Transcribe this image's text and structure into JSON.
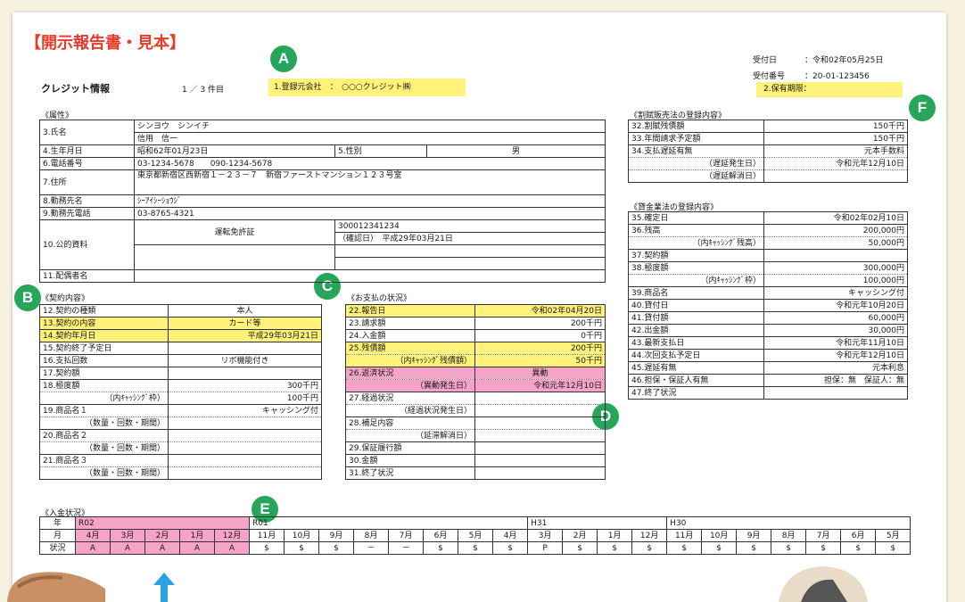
{
  "title": "【開示報告書・見本】",
  "receipt": {
    "date_label": "受付日",
    "date_value": "：令和02年05月25日",
    "no_label": "受付番号",
    "no_value": "：20-01-123456"
  },
  "credit": {
    "label": "クレジット情報",
    "count": "1 ／ 3 件目",
    "registrant": "1.登録元会社　：　○○○クレジット㈱",
    "retention": "2.保有期限："
  },
  "badges": {
    "a": "A",
    "b": "B",
    "c": "C",
    "d": "D",
    "e": "E",
    "f": "F"
  },
  "attr": {
    "section": "《属性》",
    "name_label": "3.氏名",
    "name_kana": "シンヨウ　シンイチ",
    "name_kanji": "信用　信一",
    "birth_label": "4.生年月日",
    "birth_value": "昭和62年01月23日",
    "sex_label": "5.性別",
    "sex_value": "男",
    "phone_label": "6.電話番号",
    "phone_value": "03-1234-5678　　090-1234-5678",
    "addr_label": "7.住所",
    "addr_value": "東京都新宿区西新宿１－２３－７　新宿ファーストマンション１２３号室",
    "work_label": "8.勤務先名",
    "work_value": "ｼｰｱｲｼｰｼｮｳｼﾞ",
    "workphone_label": "9.勤務先電話",
    "workphone_value": "03-8765-4321",
    "docs_label": "10.公的資料",
    "docs_type": "運転免許証",
    "docs_no": "300012341234",
    "docs_confirm": "（確認日）　平成29年03月21日",
    "spouse_label": "11.配偶者名"
  },
  "contract": {
    "section": "《契約内容》",
    "rows": [
      {
        "k": "12.契約の種類",
        "v": "本人"
      },
      {
        "k": "13.契約の内容",
        "v": "カード等"
      },
      {
        "k": "14.契約年月日",
        "v": "平成29年03月21日"
      },
      {
        "k": "15.契約終了予定日",
        "v": ""
      },
      {
        "k": "16.支払回数",
        "v": "リボ機能付き"
      },
      {
        "k": "17.契約額",
        "v": ""
      },
      {
        "k": "18.極度額",
        "v": "300千円"
      },
      {
        "k": "（内ｷｬｯｼﾝｸﾞ枠）",
        "v": "100千円"
      },
      {
        "k": "19.商品名１",
        "v": "キャッシング付"
      },
      {
        "k": "（数量・回数・期間）",
        "v": ""
      },
      {
        "k": "20.商品名２",
        "v": ""
      },
      {
        "k": "（数量・回数・期間）",
        "v": ""
      },
      {
        "k": "21.商品名３",
        "v": ""
      },
      {
        "k": "（数量・回数・期間）",
        "v": ""
      }
    ]
  },
  "payment": {
    "section": "《お支払の状況》",
    "rows": [
      {
        "k": "22.報告日",
        "v": "令和02年04月20日"
      },
      {
        "k": "23.請求額",
        "v": "200千円"
      },
      {
        "k": "24.入金額",
        "v": "0千円"
      },
      {
        "k": "25.残債額",
        "v": "200千円"
      },
      {
        "k": "（内ｷｬｯｼﾝｸﾞ残債額）",
        "v": "50千円"
      },
      {
        "k": "26.返済状況",
        "v": "異動"
      },
      {
        "k": "（異動発生日）",
        "v": "令和元年12月10日"
      },
      {
        "k": "27.経過状況",
        "v": ""
      },
      {
        "k": "（経過状況発生日）",
        "v": ""
      },
      {
        "k": "28.補足内容",
        "v": ""
      },
      {
        "k": "（延滞解消日）",
        "v": ""
      },
      {
        "k": "29.保証履行額",
        "v": ""
      },
      {
        "k": "30.金額",
        "v": ""
      },
      {
        "k": "31.終了状況",
        "v": ""
      }
    ]
  },
  "installment": {
    "section": "《割賦販売法の登録内容》",
    "rows": [
      {
        "k": "32.割賦残債額",
        "v": "150千円"
      },
      {
        "k": "33.年間請求予定額",
        "v": "150千円"
      },
      {
        "k": "34.支払遅延有無",
        "v": "元本手数料"
      },
      {
        "k": "（遅延発生日）",
        "v": "令和元年12月10日"
      },
      {
        "k": "（遅延解消日）",
        "v": ""
      }
    ]
  },
  "money": {
    "section": "《貸金業法の登録内容》",
    "rows": [
      {
        "k": "35.確定日",
        "v": "令和02年02月10日"
      },
      {
        "k": "36.残高",
        "v": "200,000円"
      },
      {
        "k": "（内ｷｬｯｼﾝｸﾞ残高）",
        "v": "50,000円"
      },
      {
        "k": "37.契約額",
        "v": ""
      },
      {
        "k": "38.極度額",
        "v": "300,000円"
      },
      {
        "k": "（内ｷｬｯｼﾝｸﾞ枠）",
        "v": "100,000円"
      },
      {
        "k": "39.商品名",
        "v": "キャッシング付"
      },
      {
        "k": "40.貸付日",
        "v": "令和元年10月20日"
      },
      {
        "k": "41.貸付額",
        "v": "60,000円"
      },
      {
        "k": "42.出金額",
        "v": "30,000円"
      },
      {
        "k": "43.最新支払日",
        "v": "令和元年11月10日"
      },
      {
        "k": "44.次回支払予定日",
        "v": "令和元年12月10日"
      },
      {
        "k": "45.遅延有無",
        "v": "元本利息"
      },
      {
        "k": "46.担保・保証人有無",
        "v": "担保：無　保証人：無"
      },
      {
        "k": "47.終了状況",
        "v": ""
      }
    ]
  },
  "deposit": {
    "section": "《入金状況》",
    "year_label": "年",
    "month_label": "月",
    "status_label": "状況",
    "years": [
      "R02",
      "R01",
      "H31",
      "H30"
    ],
    "months": [
      "4月",
      "3月",
      "2月",
      "1月",
      "12月",
      "11月",
      "10月",
      "9月",
      "8月",
      "7月",
      "6月",
      "5月",
      "4月",
      "3月",
      "2月",
      "1月",
      "12月",
      "11月",
      "10月",
      "9月",
      "8月",
      "7月",
      "6月",
      "5月"
    ],
    "statuses": [
      "A",
      "A",
      "A",
      "A",
      "A",
      "$",
      "$",
      "$",
      "－",
      "－",
      "$",
      "$",
      "$",
      "P",
      "$",
      "$",
      "$",
      "$",
      "$",
      "$",
      "$",
      "$",
      "$",
      "$"
    ]
  },
  "colors": {
    "highlight_yellow": "#fff27a",
    "highlight_pink": "#f5a3c7",
    "badge_green": "#27a55a",
    "title_red": "#e83b2a",
    "arrow_blue": "#2aa2e0"
  }
}
